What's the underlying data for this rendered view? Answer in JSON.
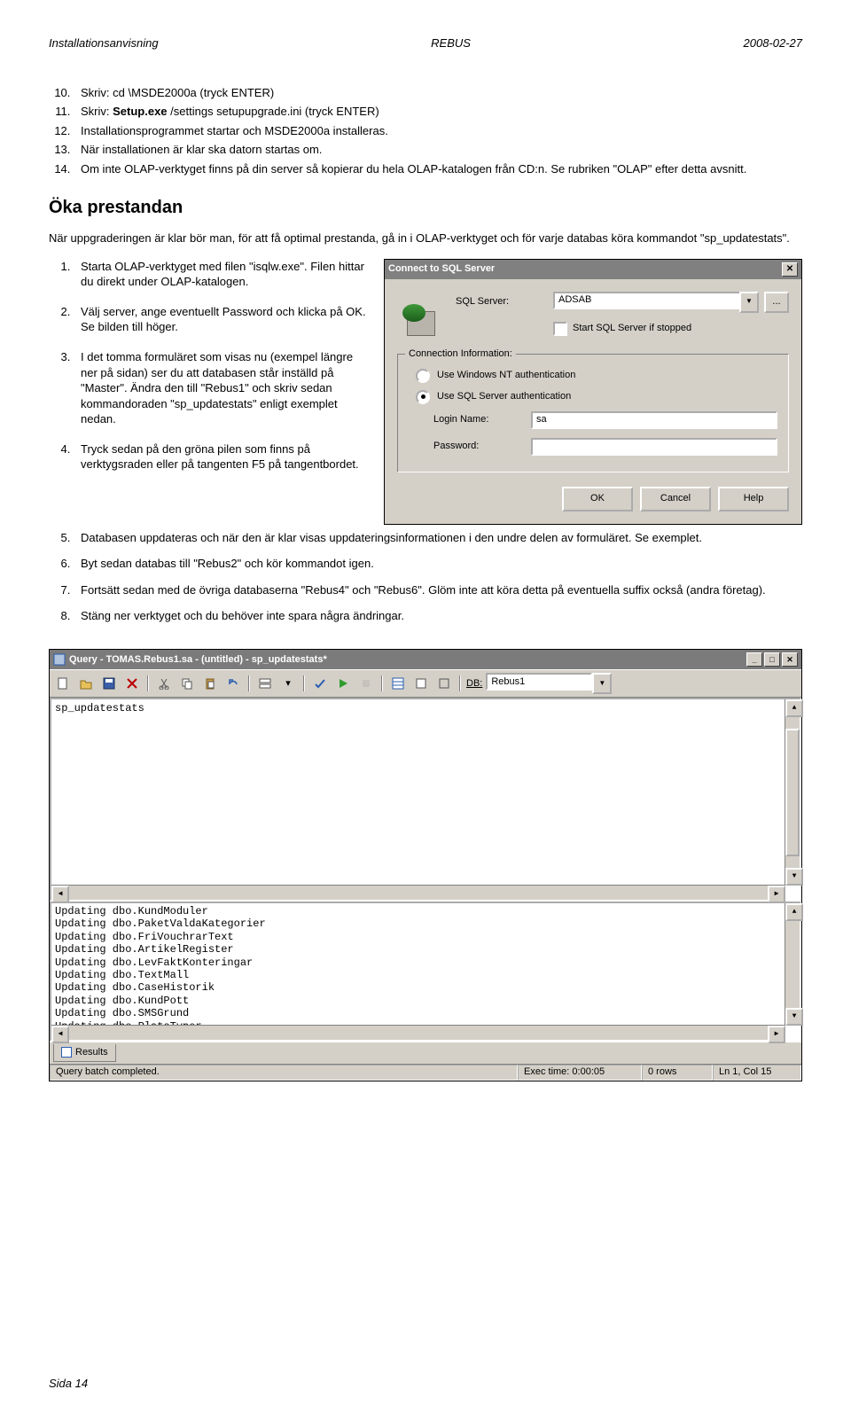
{
  "header": {
    "left": "Installationsanvisning",
    "center": "REBUS",
    "right": "2008-02-27"
  },
  "top_list": {
    "start": 10,
    "items": [
      "Skriv: cd  \\MSDE2000a    (tryck ENTER)",
      "Skriv: Setup.exe  /settings  setupupgrade.ini   (tryck ENTER)",
      "Installationsprogrammet startar och MSDE2000a installeras.",
      "När installationen är klar ska datorn startas om.",
      "Om inte OLAP-verktyget finns på din server så kopierar du hela OLAP-katalogen från CD:n. Se rubriken  \"OLAP\" efter detta avsnitt."
    ]
  },
  "heading": "Öka prestandan",
  "intro": "När uppgraderingen är klar bör man, för att få optimal prestanda, gå in i OLAP-verktyget och för varje databas köra kommandot \"sp_updatestats\".",
  "steps_left": {
    "start": 1,
    "items": [
      "Starta OLAP-verktyget med filen \"isqlw.exe\". Filen hittar du direkt under OLAP-katalogen.",
      "Välj server, ange eventuellt Password och klicka på OK. Se bilden till höger.",
      "I det tomma formuläret som visas nu (exempel längre ner på sidan) ser du att databasen står inställd på \"Master\". Ändra den till \"Rebus1\" och skriv sedan kommandoraden \"sp_updatestats\" enligt exemplet nedan.",
      "Tryck sedan på den gröna pilen som finns på verktygsraden eller på tangenten F5 på tangentbordet."
    ]
  },
  "steps_below": {
    "start": 5,
    "items": [
      "Databasen uppdateras och när den är klar visas uppdateringsinformationen i den undre delen av formuläret. Se exemplet.",
      "Byt sedan databas till \"Rebus2\" och kör kommandot igen.",
      "Fortsätt sedan med de övriga databaserna \"Rebus4\" och \"Rebus6\". Glöm inte att köra detta på eventuella suffix också (andra företag).",
      "Stäng ner verktyget och du behöver inte spara några ändringar."
    ]
  },
  "connect_dialog": {
    "title": "Connect to SQL Server",
    "server_label": "SQL Server:",
    "server_value": "ADSAB",
    "start_checkbox": "Start SQL Server if stopped",
    "fieldset": "Connection Information:",
    "radio_nt": "Use Windows NT authentication",
    "radio_sql": "Use SQL Server authentication",
    "login_label": "Login Name:",
    "login_value": "sa",
    "password_label": "Password:",
    "password_value": "",
    "ok": "OK",
    "cancel": "Cancel",
    "help": "Help"
  },
  "query_window": {
    "title": "Query - TOMAS.Rebus1.sa - (untitled) - sp_updatestats*",
    "db_label": "DB:",
    "db_value": "Rebus1",
    "editor_text": "sp_updatestats",
    "results": [
      "Updating dbo.KundModuler",
      "Updating dbo.PaketValdaKategorier",
      "Updating dbo.FriVouchrarText",
      "Updating dbo.ArtikelRegister",
      "Updating dbo.LevFaktKonteringar",
      "Updating dbo.TextMall",
      "Updating dbo.CaseHistorik",
      "Updating dbo.KundPott",
      "Updating dbo.SMSGrund",
      "Updating dbo.PlatsTyper"
    ],
    "tab": "Results",
    "status": {
      "msg": "Query batch completed.",
      "exec": "Exec time: 0:00:05",
      "rows": "0 rows",
      "pos": "Ln 1, Col 15"
    }
  },
  "footer": "Sida  14"
}
